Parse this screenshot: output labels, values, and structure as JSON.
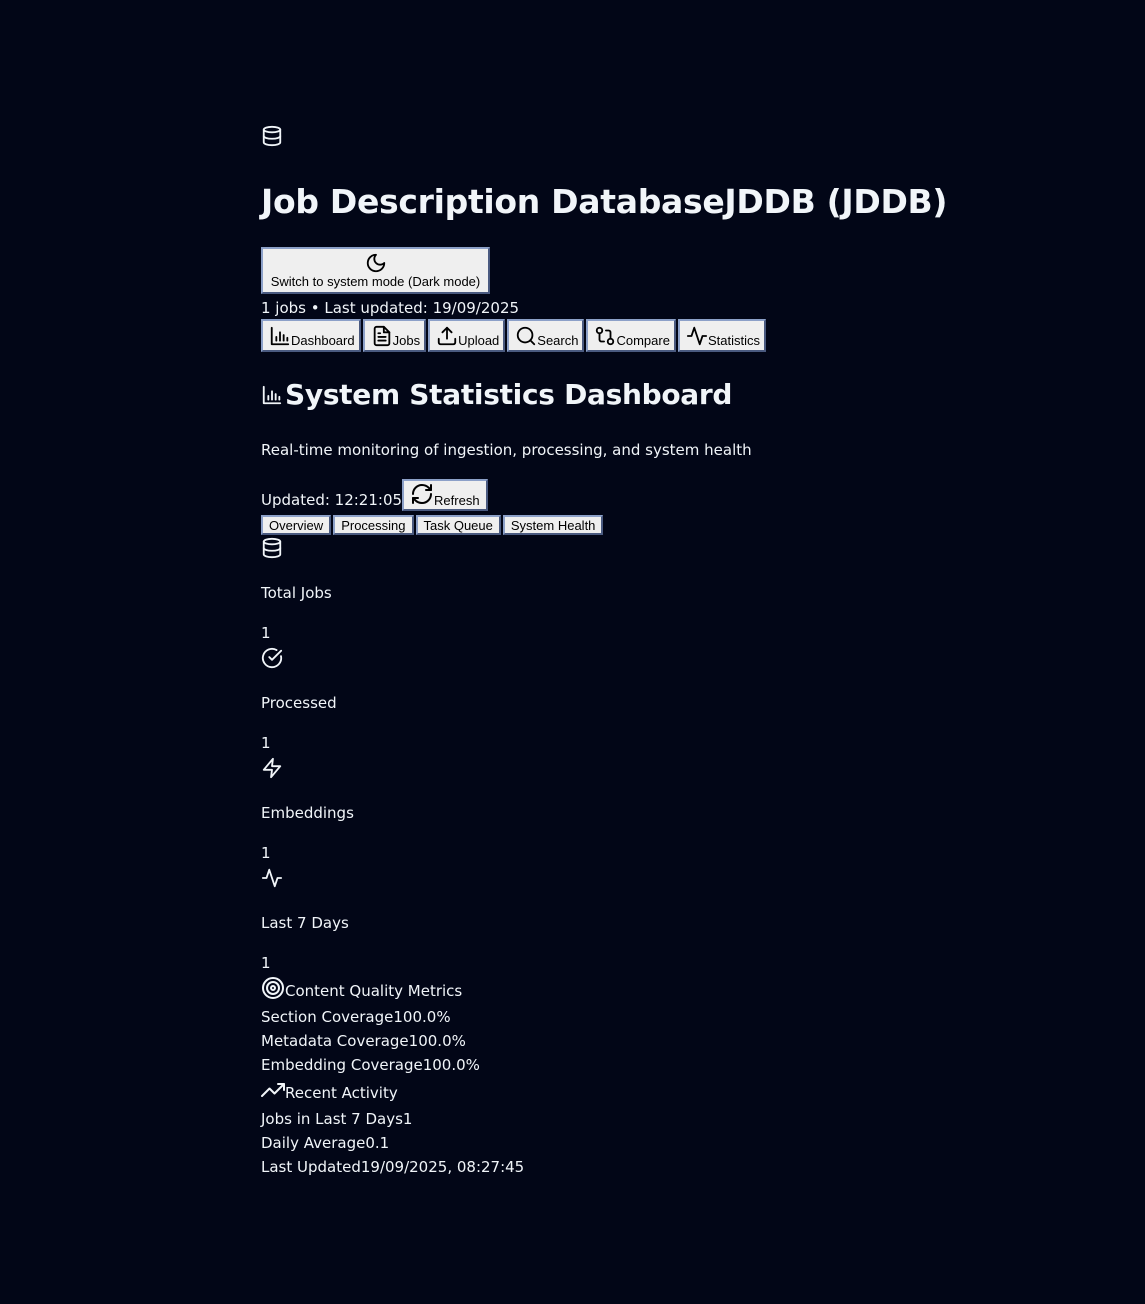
{
  "header": {
    "logo_icon": "database-icon",
    "title": "Job Description DatabaseJDDB (JDDB)",
    "theme_button_label": "Switch to system mode (Dark mode)",
    "theme_icon": "moon-icon",
    "meta": "1 jobs • Last updated: 19/09/2025"
  },
  "nav": {
    "items": [
      {
        "label": "Dashboard",
        "icon": "bar-chart-icon"
      },
      {
        "label": "Jobs",
        "icon": "file-text-icon"
      },
      {
        "label": "Upload",
        "icon": "upload-icon"
      },
      {
        "label": "Search",
        "icon": "search-icon"
      },
      {
        "label": "Compare",
        "icon": "git-compare-icon"
      },
      {
        "label": "Statistics",
        "icon": "activity-icon"
      }
    ]
  },
  "main": {
    "title": "System Statistics Dashboard",
    "title_icon": "bar-chart-icon",
    "subtitle": "Real-time monitoring of ingestion, processing, and system health",
    "updated": "Updated: 12:21:05",
    "refresh_label": "Refresh",
    "tabs": [
      {
        "label": "Overview"
      },
      {
        "label": "Processing"
      },
      {
        "label": "Task Queue"
      },
      {
        "label": "System Health"
      }
    ],
    "stats": [
      {
        "label": "Total Jobs",
        "value": "1",
        "icon": "database-icon"
      },
      {
        "label": "Processed",
        "value": "1",
        "icon": "check-circle-icon"
      },
      {
        "label": "Embeddings",
        "value": "1",
        "icon": "zap-icon"
      },
      {
        "label": "Last 7 Days",
        "value": "1",
        "icon": "activity-icon"
      }
    ],
    "quality": {
      "title": "Content Quality Metrics",
      "icon": "target-icon",
      "rows": [
        {
          "label": "Section Coverage",
          "value": "100.0%"
        },
        {
          "label": "Metadata Coverage",
          "value": "100.0%"
        },
        {
          "label": "Embedding Coverage",
          "value": "100.0%"
        }
      ]
    },
    "activity": {
      "title": "Recent Activity",
      "icon": "trending-up-icon",
      "rows": [
        {
          "label": "Jobs in Last 7 Days",
          "value": "1"
        },
        {
          "label": "Daily Average",
          "value": "0.1"
        },
        {
          "label": "Last Updated",
          "value": "19/09/2025, 08:27:45"
        }
      ]
    }
  }
}
